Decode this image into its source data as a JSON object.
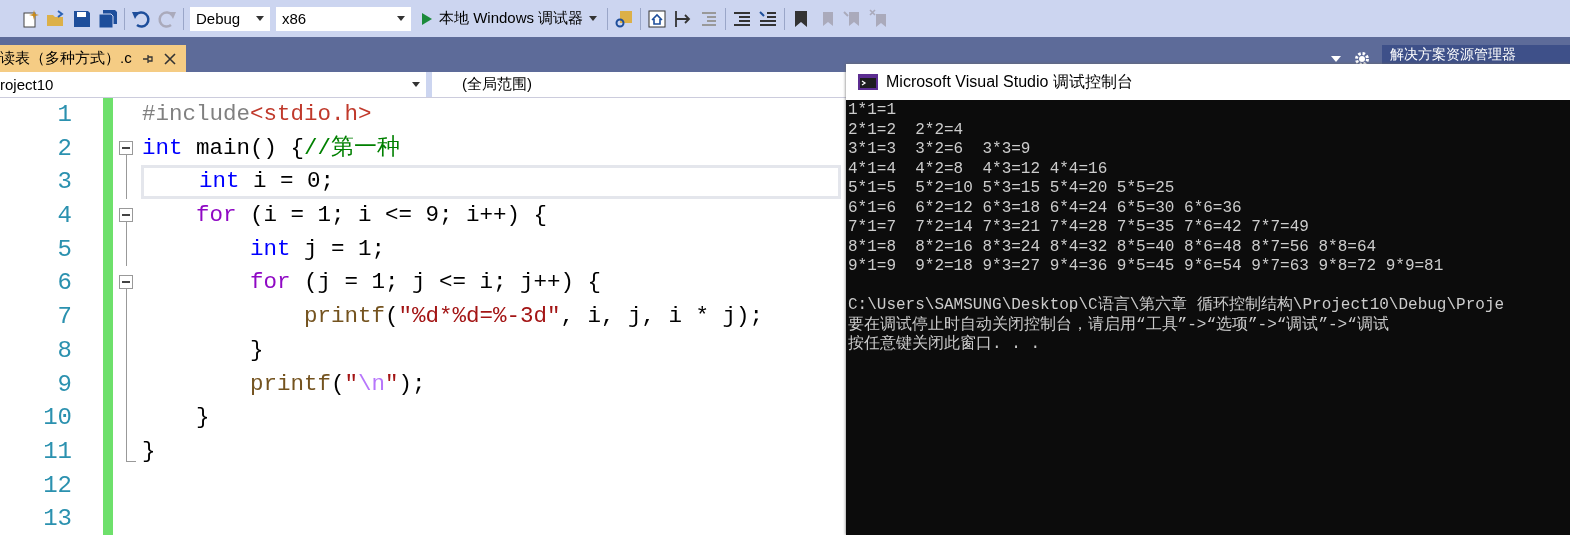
{
  "toolbar": {
    "configuration": "Debug",
    "platform": "x86",
    "run_label": "本地 Windows 调试器"
  },
  "tab": {
    "title": "读表（多种方式）.c",
    "selected": true
  },
  "panel_tab": "解决方案资源管理器",
  "nav": {
    "project": "roject10",
    "scope": "(全局范围)"
  },
  "editor": {
    "lines": [
      {
        "number": "1",
        "collapsible": false,
        "current": false,
        "tokens": [
          {
            "kind": "preproc",
            "text": "#include"
          },
          {
            "kind": "header",
            "text": "<stdio.h>"
          }
        ]
      },
      {
        "number": "2",
        "collapsible": true,
        "current": false,
        "tokens": [
          {
            "kind": "keyword",
            "text": "int"
          },
          {
            "kind": "plain",
            "text": " main() {"
          },
          {
            "kind": "comment",
            "text": "//第一种"
          }
        ]
      },
      {
        "number": "3",
        "collapsible": false,
        "current": true,
        "tokens": [
          {
            "kind": "keyword",
            "text": "    int"
          },
          {
            "kind": "plain",
            "text": " i = 0;"
          }
        ]
      },
      {
        "number": "4",
        "collapsible": true,
        "current": false,
        "tokens": [
          {
            "kind": "control",
            "text": "    for"
          },
          {
            "kind": "plain",
            "text": " (i = 1; i <= 9; i++) {"
          }
        ]
      },
      {
        "number": "5",
        "collapsible": false,
        "current": false,
        "tokens": [
          {
            "kind": "keyword",
            "text": "        int"
          },
          {
            "kind": "plain",
            "text": " j = 1;"
          }
        ]
      },
      {
        "number": "6",
        "collapsible": true,
        "current": false,
        "tokens": [
          {
            "kind": "control",
            "text": "        for"
          },
          {
            "kind": "plain",
            "text": " (j = 1; j <= i; j++) {"
          }
        ]
      },
      {
        "number": "7",
        "collapsible": false,
        "current": false,
        "tokens": [
          {
            "kind": "func",
            "text": "            printf"
          },
          {
            "kind": "plain",
            "text": "("
          },
          {
            "kind": "string",
            "text": "\"%d*%d=%-3d\""
          },
          {
            "kind": "plain",
            "text": ", i, j, i * j);"
          }
        ]
      },
      {
        "number": "8",
        "collapsible": false,
        "current": false,
        "tokens": [
          {
            "kind": "plain",
            "text": "        }"
          }
        ]
      },
      {
        "number": "9",
        "collapsible": false,
        "current": false,
        "tokens": [
          {
            "kind": "func",
            "text": "        printf"
          },
          {
            "kind": "plain",
            "text": "("
          },
          {
            "kind": "string",
            "text": "\""
          },
          {
            "kind": "escape",
            "text": "\\n"
          },
          {
            "kind": "string",
            "text": "\""
          },
          {
            "kind": "plain",
            "text": ");"
          }
        ]
      },
      {
        "number": "10",
        "collapsible": false,
        "current": false,
        "tokens": [
          {
            "kind": "plain",
            "text": "    }"
          }
        ]
      },
      {
        "number": "11",
        "collapsible": false,
        "current": false,
        "tokens": [
          {
            "kind": "plain",
            "text": "}"
          }
        ]
      },
      {
        "number": "12",
        "collapsible": false,
        "current": false
      },
      {
        "number": "13",
        "collapsible": false,
        "current": false
      }
    ]
  },
  "console": {
    "title": "Microsoft Visual Studio 调试控制台",
    "output": [
      "1*1=1",
      "2*1=2  2*2=4",
      "3*1=3  3*2=6  3*3=9",
      "4*1=4  4*2=8  4*3=12 4*4=16",
      "5*1=5  5*2=10 5*3=15 5*4=20 5*5=25",
      "6*1=6  6*2=12 6*3=18 6*4=24 6*5=30 6*6=36",
      "7*1=7  7*2=14 7*3=21 7*4=28 7*5=35 7*6=42 7*7=49",
      "8*1=8  8*2=16 8*3=24 8*4=32 8*5=40 8*6=48 8*7=56 8*8=64",
      "9*1=9  9*2=18 9*3=27 9*4=36 9*5=45 9*6=54 9*7=63 9*8=72 9*9=81"
    ],
    "messages": [
      "C:\\Users\\SAMSUNG\\Desktop\\C语言\\第六章 循环控制结构\\Project10\\Debug\\Proje",
      "要在调试停止时自动关闭控制台，请启用“工具”->“选项”->“调试”->“调试",
      "按任意键关闭此窗口. . ."
    ]
  }
}
